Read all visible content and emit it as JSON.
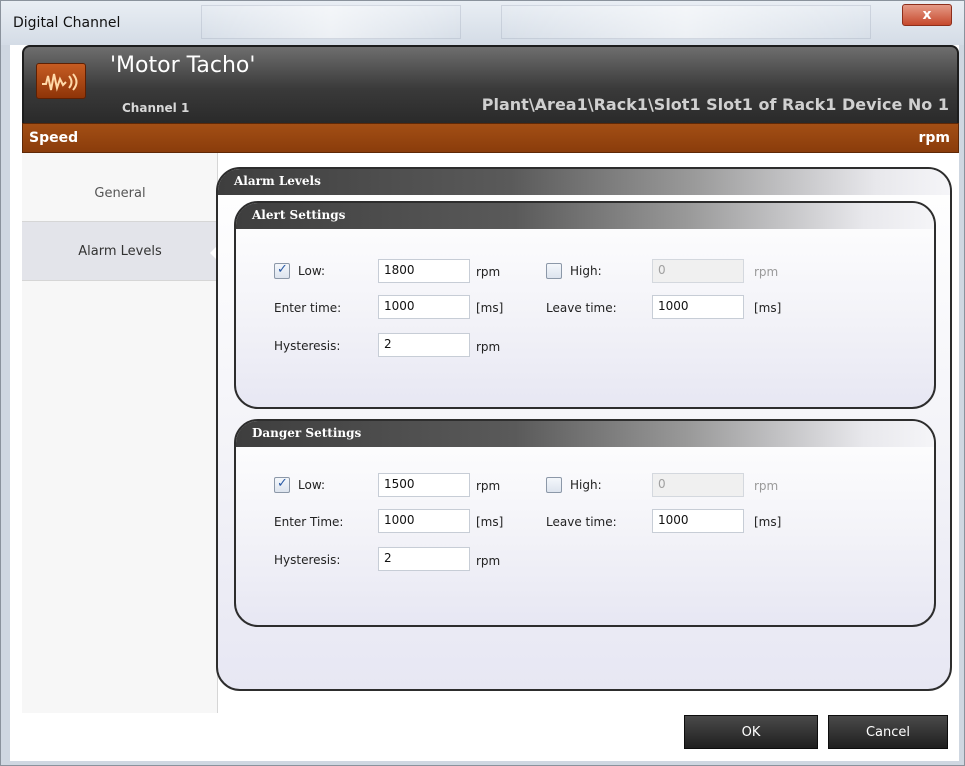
{
  "window": {
    "title": "Digital Channel",
    "close_label": "x"
  },
  "header": {
    "title": "'Motor Tacho'",
    "subtitle": "Channel 1",
    "path": "Plant\\Area1\\Rack1\\Slot1 Slot1 of Rack1 Device No 1",
    "logo_icon": "waveform-icon"
  },
  "measurement": {
    "label": "Speed",
    "unit": "rpm"
  },
  "nav": {
    "items": [
      {
        "label": "General",
        "active": false
      },
      {
        "label": "Alarm Levels",
        "active": true
      }
    ]
  },
  "alarm_levels": {
    "title": "Alarm Levels",
    "alert": {
      "title": "Alert Settings",
      "low_label": "Low:",
      "low_checked": true,
      "low_value": "1800",
      "low_unit": "rpm",
      "high_label": "High:",
      "high_checked": false,
      "high_value": "0",
      "high_unit": "rpm",
      "enter_label": "Enter time:",
      "enter_value": "1000",
      "enter_unit": "[ms]",
      "leave_label": "Leave time:",
      "leave_value": "1000",
      "leave_unit": "[ms]",
      "hyst_label": "Hysteresis:",
      "hyst_value": "2",
      "hyst_unit": "rpm"
    },
    "danger": {
      "title": "Danger Settings",
      "low_label": "Low:",
      "low_checked": true,
      "low_value": "1500",
      "low_unit": "rpm",
      "high_label": "High:",
      "high_checked": false,
      "high_value": "0",
      "high_unit": "rpm",
      "enter_label": "Enter Time:",
      "enter_value": "1000",
      "enter_unit": "[ms]",
      "leave_label": "Leave time:",
      "leave_value": "1000",
      "leave_unit": "[ms]",
      "hyst_label": "Hysteresis:",
      "hyst_value": "2",
      "hyst_unit": "rpm"
    }
  },
  "footer": {
    "ok_label": "OK",
    "cancel_label": "Cancel"
  },
  "colors": {
    "accent": "#963f0e",
    "header_dark": "#2a2a2a"
  }
}
